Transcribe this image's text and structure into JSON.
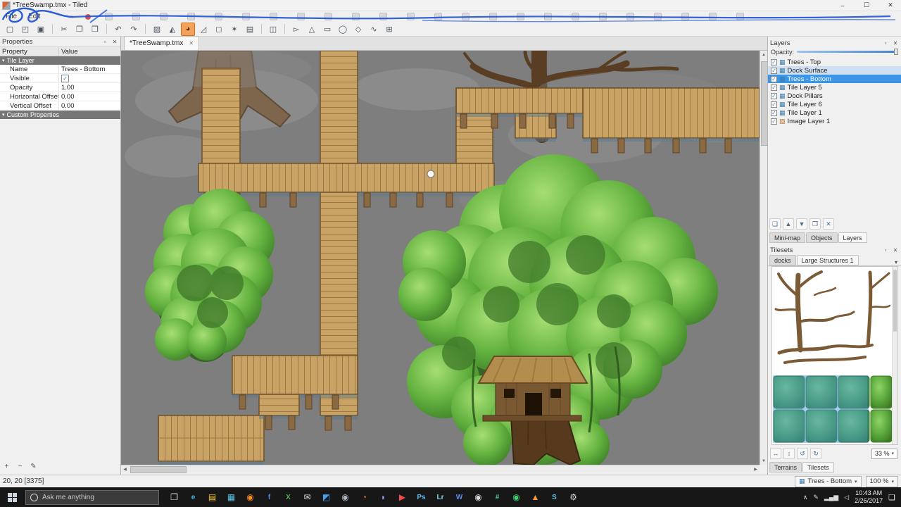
{
  "window": {
    "title": "*TreeSwamp.tmx - Tiled",
    "minimize": "–",
    "maximize": "☐",
    "close": "✕"
  },
  "menubar": {
    "items": [
      "File",
      "Edit"
    ]
  },
  "overlay": {
    "annotation_color": "#1f53d6",
    "icon_count": 24
  },
  "toolbar": {
    "tools": [
      {
        "name": "new-map",
        "glyph": "▢"
      },
      {
        "name": "open-file",
        "glyph": "◰"
      },
      {
        "name": "save-file",
        "glyph": "▣"
      },
      {
        "sep": true
      },
      {
        "name": "cut",
        "glyph": "✂"
      },
      {
        "name": "copy",
        "glyph": "❐"
      },
      {
        "name": "paste",
        "glyph": "❒"
      },
      {
        "sep": true
      },
      {
        "name": "undo",
        "glyph": "↶"
      },
      {
        "name": "redo",
        "glyph": "↷"
      },
      {
        "sep": true
      },
      {
        "name": "stamp-brush",
        "glyph": "▨"
      },
      {
        "name": "terrain-brush",
        "glyph": "◭"
      },
      {
        "name": "bucket-fill",
        "glyph": "◕",
        "active": true
      },
      {
        "name": "eraser",
        "glyph": "◿"
      },
      {
        "name": "rectangular-select",
        "glyph": "◻"
      },
      {
        "name": "magic-wand",
        "glyph": "✶"
      },
      {
        "name": "select-same-tile",
        "glyph": "▤"
      },
      {
        "sep": true
      },
      {
        "name": "crop",
        "glyph": "◫"
      },
      {
        "sep": true
      },
      {
        "name": "select-objects",
        "glyph": "▻"
      },
      {
        "name": "edit-polygons",
        "glyph": "△"
      },
      {
        "name": "insert-rectangle",
        "glyph": "▭"
      },
      {
        "name": "insert-ellipse",
        "glyph": "◯"
      },
      {
        "name": "insert-polygon",
        "glyph": "◇"
      },
      {
        "name": "insert-polyline",
        "glyph": "∿"
      },
      {
        "name": "insert-tile",
        "glyph": "⊞"
      }
    ]
  },
  "properties": {
    "title": "Properties",
    "columns": [
      "Property",
      "Value"
    ],
    "groups": {
      "main": "Tile Layer",
      "custom": "Custom Properties"
    },
    "rows": [
      {
        "property": "Name",
        "value": "Trees - Bottom",
        "type": "text"
      },
      {
        "property": "Visible",
        "value": "✓",
        "type": "check"
      },
      {
        "property": "Opacity",
        "value": "1.00",
        "type": "text"
      },
      {
        "property": "Horizontal Offset",
        "value": "0.00",
        "type": "text"
      },
      {
        "property": "Vertical Offset",
        "value": "0.00",
        "type": "text"
      }
    ],
    "toolbar": [
      {
        "name": "add-property",
        "glyph": "+"
      },
      {
        "name": "remove-property",
        "glyph": "−"
      },
      {
        "name": "rename-property",
        "glyph": "✎"
      }
    ]
  },
  "document_tab": {
    "label": "*TreeSwamp.tmx",
    "close": "✕"
  },
  "layers_panel": {
    "title": "Layers",
    "opacity_label": "Opacity:",
    "items": [
      {
        "label": "Trees - Top",
        "type": "tile"
      },
      {
        "label": "Dock Surface",
        "type": "tile",
        "hover": true
      },
      {
        "label": "Trees - Bottom",
        "type": "tile",
        "selected": true
      },
      {
        "label": "Tile Layer 5",
        "type": "tile"
      },
      {
        "label": "Dock Pillars",
        "type": "tile"
      },
      {
        "label": "Tile Layer 6",
        "type": "tile"
      },
      {
        "label": "Tile Layer 1",
        "type": "tile"
      },
      {
        "label": "Image Layer 1",
        "type": "image"
      }
    ],
    "toolbar": [
      {
        "name": "new-layer",
        "glyph": "❏"
      },
      {
        "name": "raise-layer",
        "glyph": "▲"
      },
      {
        "name": "lower-layer",
        "glyph": "▼"
      },
      {
        "name": "duplicate-layer",
        "glyph": "❐"
      },
      {
        "name": "remove-layer",
        "glyph": "✕"
      }
    ],
    "dock_tabs": [
      {
        "label": "Mini-map"
      },
      {
        "label": "Objects"
      },
      {
        "label": "Layers",
        "active": true
      }
    ]
  },
  "tilesets_panel": {
    "title": "Tilesets",
    "tabs": [
      {
        "label": "docks"
      },
      {
        "label": "Large Structures 1",
        "active": true
      }
    ],
    "toolbar": [
      {
        "name": "flip-horizontal",
        "glyph": "↔"
      },
      {
        "name": "flip-vertical",
        "glyph": "↕"
      },
      {
        "name": "rotate-left",
        "glyph": "↺"
      },
      {
        "name": "rotate-right",
        "glyph": "↻"
      }
    ],
    "zoom": "33 %",
    "dock_tabs": [
      {
        "label": "Terrains"
      },
      {
        "label": "Tilesets",
        "active": true
      }
    ]
  },
  "statusbar": {
    "coordinates": "20, 20 [3375]",
    "current_layer": "Trees - Bottom",
    "zoom": "100 %"
  },
  "taskbar": {
    "search_placeholder": "Ask me anything",
    "icons": [
      {
        "name": "task-view",
        "glyph": "❐",
        "color": "#e8e8e8"
      },
      {
        "name": "edge",
        "glyph": "e",
        "color": "#45b4f0"
      },
      {
        "name": "file-explorer",
        "glyph": "▤",
        "color": "#f7c33c"
      },
      {
        "name": "store",
        "glyph": "▦",
        "color": "#58c4e8"
      },
      {
        "name": "firefox",
        "glyph": "◉",
        "color": "#ff8c1a"
      },
      {
        "name": "facebook",
        "glyph": "f",
        "color": "#5a85e8"
      },
      {
        "name": "excel",
        "glyph": "X",
        "color": "#4fb055"
      },
      {
        "name": "mail",
        "glyph": "✉",
        "color": "#d8e0e8"
      },
      {
        "name": "photos",
        "glyph": "◩",
        "color": "#4aa3e8"
      },
      {
        "name": "steam",
        "glyph": "◉",
        "color": "#aeb9c4"
      },
      {
        "name": "chrome",
        "glyph": "◔",
        "color": "#e06a50"
      },
      {
        "name": "discord",
        "glyph": "◗",
        "color": "#8b9cf5"
      },
      {
        "name": "youtube",
        "glyph": "▶",
        "color": "#f04a4a"
      },
      {
        "name": "photoshop",
        "glyph": "Ps",
        "color": "#58b5f5"
      },
      {
        "name": "lightroom",
        "glyph": "Lr",
        "color": "#7fd4f7"
      },
      {
        "name": "word",
        "glyph": "W",
        "color": "#5a8ff0"
      },
      {
        "name": "github",
        "glyph": "◉",
        "color": "#d8dde2"
      },
      {
        "name": "slack",
        "glyph": "#",
        "color": "#4fc3a8"
      },
      {
        "name": "spotify",
        "glyph": "◉",
        "color": "#3dd870"
      },
      {
        "name": "vlc",
        "glyph": "▲",
        "color": "#ff9a2a"
      },
      {
        "name": "skype",
        "glyph": "S",
        "color": "#58c2f0"
      },
      {
        "name": "settings",
        "glyph": "⚙",
        "color": "#cfd6dd"
      }
    ],
    "tray_icons": [
      {
        "name": "tray-expand",
        "glyph": "∧"
      },
      {
        "name": "pen",
        "glyph": "✎"
      },
      {
        "name": "network",
        "glyph": "▂▄▆"
      },
      {
        "name": "volume",
        "glyph": "◁"
      }
    ],
    "clock_time": "10:43 AM",
    "clock_date": "2/26/2017",
    "notification": "❏"
  },
  "colors": {
    "selection": "#3d95e8",
    "canvas_bg": "#7e7e7e",
    "taskbar_bg": "#171717",
    "active_tool_highlight": "#f4a259"
  }
}
